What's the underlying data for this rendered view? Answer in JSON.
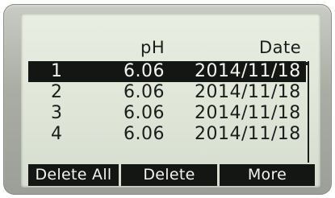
{
  "header": {
    "ph_label": "pH",
    "date_label": "Date"
  },
  "rows": [
    {
      "num": "1",
      "ph": "6.06",
      "date": "2014/11/18",
      "selected": true
    },
    {
      "num": "2",
      "ph": "6.06",
      "date": "2014/11/18",
      "selected": false
    },
    {
      "num": "3",
      "ph": "6.06",
      "date": "2014/11/18",
      "selected": false
    },
    {
      "num": "4",
      "ph": "6.06",
      "date": "2014/11/18",
      "selected": false
    }
  ],
  "softkeys": {
    "delete_all": "Delete All",
    "delete": "Delete",
    "more": "More"
  },
  "colors": {
    "lcd_background": "#dfe6d8",
    "pixel_dark": "#141614",
    "bezel": "#a9ada4"
  }
}
